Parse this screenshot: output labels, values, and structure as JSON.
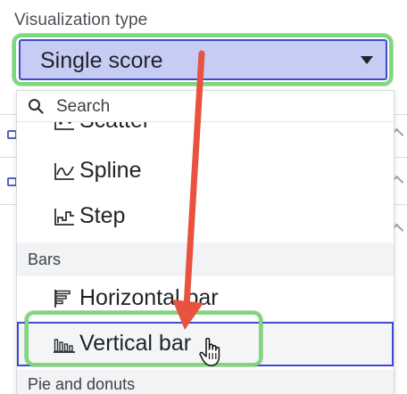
{
  "field": {
    "label": "Visualization type",
    "selected_value": "Single score"
  },
  "dropdown": {
    "search_placeholder": "Search",
    "items_partial_top": {
      "label": "Scatter",
      "icon": "scatter-chart-icon"
    },
    "line_items": [
      {
        "label": "Spline",
        "icon": "spline-chart-icon"
      },
      {
        "label": "Step",
        "icon": "step-chart-icon"
      }
    ],
    "groups": [
      {
        "header": "Bars",
        "items": [
          {
            "label": "Horizontal bar",
            "icon": "horizontal-bar-chart-icon"
          },
          {
            "label": "Vertical bar",
            "icon": "vertical-bar-chart-icon"
          }
        ]
      },
      {
        "header": "Pie and donuts"
      }
    ]
  },
  "colors": {
    "select_bg": "#c6ccf3",
    "select_border": "#3f4ad1",
    "highlight_green": "#7bd87b",
    "arrow_red": "#e8533f"
  }
}
